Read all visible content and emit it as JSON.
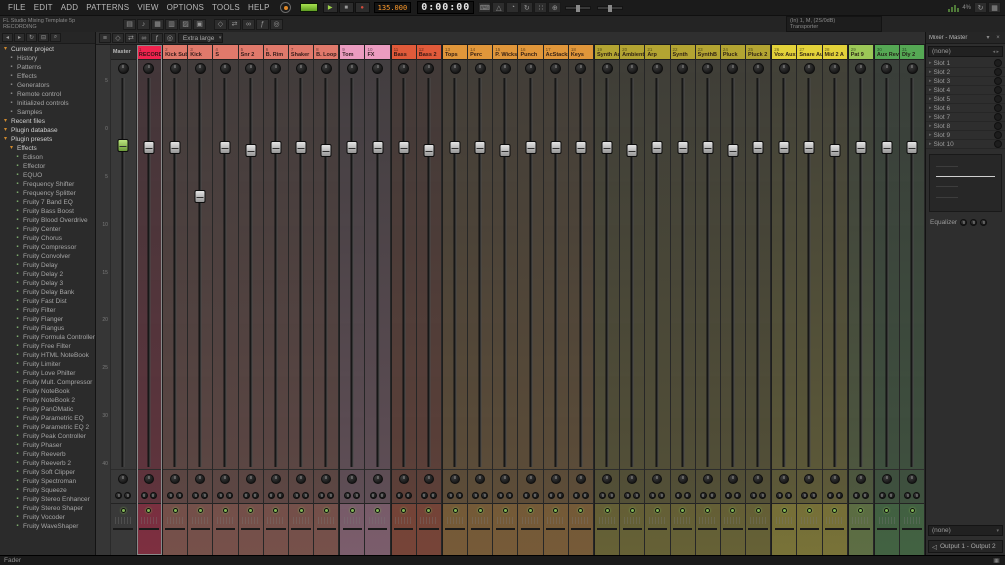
{
  "window": {
    "menu": [
      "FILE",
      "EDIT",
      "ADD",
      "PATTERNS",
      "VIEW",
      "OPTIONS",
      "TOOLS",
      "HELP"
    ],
    "project_title": "FL Studio Mixing Template 5p",
    "pattern_name": "RECORDING",
    "tempo": "135.000",
    "time": "0:00:00",
    "cpu": "4%",
    "hint_line1": "(In) 1, M, (2S/0dB)",
    "hint_line2": "Transporter",
    "transport_icons": [
      "play-icon",
      "stop-icon",
      "record-icon"
    ],
    "tool_icons": [
      "typing-keyboard-icon",
      "metronome-icon",
      "wait-icon",
      "loop-record-icon",
      "step-edit-icon",
      "multilink-icon"
    ],
    "sys_icons": [
      "refresh-icon",
      "monitor-icon"
    ]
  },
  "toolbar2": {
    "panel_icons": [
      "playlist-icon",
      "piano-roll-icon",
      "channel-rack-icon",
      "mixer-icon",
      "browser-icon",
      "plugin-picker-icon"
    ],
    "extra_icons": [
      "snap-icon",
      "swap-icon",
      "link-icon",
      "fx-icon",
      "solo-icon"
    ]
  },
  "browser": {
    "toolbar_icons": [
      "back-icon",
      "forward-icon",
      "refresh-icon",
      "collapse-icon",
      "search-icon"
    ],
    "items": [
      {
        "label": "Current project",
        "depth": 0,
        "type": "folder"
      },
      {
        "label": "History",
        "depth": 1,
        "type": "item"
      },
      {
        "label": "Patterns",
        "depth": 1,
        "type": "item"
      },
      {
        "label": "Effects",
        "depth": 1,
        "type": "item"
      },
      {
        "label": "Generators",
        "depth": 1,
        "type": "item"
      },
      {
        "label": "Remote control",
        "depth": 1,
        "type": "item"
      },
      {
        "label": "Initialized controls",
        "depth": 1,
        "type": "item"
      },
      {
        "label": "Samples",
        "depth": 1,
        "type": "item"
      },
      {
        "label": "Recent files",
        "depth": 0,
        "type": "folder"
      },
      {
        "label": "Plugin database",
        "depth": 0,
        "type": "folder"
      },
      {
        "label": "Plugin presets",
        "depth": 0,
        "type": "folder"
      },
      {
        "label": "Effects",
        "depth": 1,
        "type": "folder"
      },
      {
        "label": "Edison",
        "depth": 2,
        "type": "plugin"
      },
      {
        "label": "Effector",
        "depth": 2,
        "type": "plugin"
      },
      {
        "label": "EQUO",
        "depth": 2,
        "type": "plugin"
      },
      {
        "label": "Frequency Shifter",
        "depth": 2,
        "type": "plugin"
      },
      {
        "label": "Frequency Splitter",
        "depth": 2,
        "type": "plugin"
      },
      {
        "label": "Fruity 7 Band EQ",
        "depth": 2,
        "type": "plugin"
      },
      {
        "label": "Fruity Bass Boost",
        "depth": 2,
        "type": "plugin"
      },
      {
        "label": "Fruity Blood Overdrive",
        "depth": 2,
        "type": "plugin"
      },
      {
        "label": "Fruity Center",
        "depth": 2,
        "type": "plugin"
      },
      {
        "label": "Fruity Chorus",
        "depth": 2,
        "type": "plugin"
      },
      {
        "label": "Fruity Compressor",
        "depth": 2,
        "type": "plugin"
      },
      {
        "label": "Fruity Convolver",
        "depth": 2,
        "type": "plugin"
      },
      {
        "label": "Fruity Delay",
        "depth": 2,
        "type": "plugin"
      },
      {
        "label": "Fruity Delay 2",
        "depth": 2,
        "type": "plugin"
      },
      {
        "label": "Fruity Delay 3",
        "depth": 2,
        "type": "plugin"
      },
      {
        "label": "Fruity Delay Bank",
        "depth": 2,
        "type": "plugin"
      },
      {
        "label": "Fruity Fast Dist",
        "depth": 2,
        "type": "plugin"
      },
      {
        "label": "Fruity Filter",
        "depth": 2,
        "type": "plugin"
      },
      {
        "label": "Fruity Flanger",
        "depth": 2,
        "type": "plugin"
      },
      {
        "label": "Fruity Flangus",
        "depth": 2,
        "type": "plugin"
      },
      {
        "label": "Fruity Formula Controller",
        "depth": 2,
        "type": "plugin"
      },
      {
        "label": "Fruity Free Filter",
        "depth": 2,
        "type": "plugin"
      },
      {
        "label": "Fruity HTML NoteBook",
        "depth": 2,
        "type": "plugin"
      },
      {
        "label": "Fruity Limiter",
        "depth": 2,
        "type": "plugin"
      },
      {
        "label": "Fruity Love Philter",
        "depth": 2,
        "type": "plugin"
      },
      {
        "label": "Fruity Mult. Compressor",
        "depth": 2,
        "type": "plugin"
      },
      {
        "label": "Fruity NoteBook",
        "depth": 2,
        "type": "plugin"
      },
      {
        "label": "Fruity NoteBook 2",
        "depth": 2,
        "type": "plugin"
      },
      {
        "label": "Fruity PanOMatic",
        "depth": 2,
        "type": "plugin"
      },
      {
        "label": "Fruity Parametric EQ",
        "depth": 2,
        "type": "plugin"
      },
      {
        "label": "Fruity Parametric EQ 2",
        "depth": 2,
        "type": "plugin"
      },
      {
        "label": "Fruity Peak Controller",
        "depth": 2,
        "type": "plugin"
      },
      {
        "label": "Fruity Phaser",
        "depth": 2,
        "type": "plugin"
      },
      {
        "label": "Fruity Reeverb",
        "depth": 2,
        "type": "plugin"
      },
      {
        "label": "Fruity Reeverb 2",
        "depth": 2,
        "type": "plugin"
      },
      {
        "label": "Fruity Soft Clipper",
        "depth": 2,
        "type": "plugin"
      },
      {
        "label": "Fruity Spectroman",
        "depth": 2,
        "type": "plugin"
      },
      {
        "label": "Fruity Squeeze",
        "depth": 2,
        "type": "plugin"
      },
      {
        "label": "Fruity Stereo Enhancer",
        "depth": 2,
        "type": "plugin"
      },
      {
        "label": "Fruity Stereo Shaper",
        "depth": 2,
        "type": "plugin"
      },
      {
        "label": "Fruity Vocoder",
        "depth": 2,
        "type": "plugin"
      },
      {
        "label": "Fruity WaveShaper",
        "depth": 2,
        "type": "plugin"
      }
    ]
  },
  "mixer": {
    "view_size": "Extra large",
    "master_label": "Master",
    "master_fader": 0.165,
    "toolbar_icons": [
      "mixer-menu-icon",
      "snap-icon",
      "swap-icon",
      "link-icon",
      "fx-icon",
      "solo-icon"
    ],
    "ruler": [
      "5",
      "0",
      "5",
      "10",
      "15",
      "20",
      "25",
      "30",
      "40"
    ],
    "channels": [
      {
        "num": "1",
        "name": "RECORDING",
        "color": "#f0234e",
        "fader": 0.17,
        "selected": true
      },
      {
        "num": "2",
        "name": "Kick Sub",
        "color": "#e0796b",
        "fader": 0.17
      },
      {
        "num": "3",
        "name": "Kick",
        "color": "#e0796b",
        "fader": 0.3
      },
      {
        "num": "4",
        "name": "S",
        "color": "#e0796b",
        "fader": 0.17
      },
      {
        "num": "5",
        "name": "Snr 2",
        "color": "#e0796b",
        "fader": 0.18
      },
      {
        "num": "6",
        "name": "B. Rim",
        "color": "#e0796b",
        "fader": 0.17
      },
      {
        "num": "7",
        "name": "Shaker",
        "color": "#e0796b",
        "fader": 0.17
      },
      {
        "num": "8",
        "name": "B. Loop",
        "color": "#e0796b",
        "fader": 0.18
      },
      {
        "num": "9",
        "name": "Tom",
        "color": "#eb9cc0",
        "fader": 0.17
      },
      {
        "num": "10",
        "name": "FX",
        "color": "#eb9cc0",
        "fader": 0.17
      },
      {
        "num": "11",
        "name": "Bass",
        "color": "#e05a3a",
        "fader": 0.17
      },
      {
        "num": "12",
        "name": "Bass 2",
        "color": "#e05a3a",
        "fader": 0.18
      },
      {
        "num": "13",
        "name": "Tops",
        "color": "#e0963a",
        "fader": 0.17
      },
      {
        "num": "14",
        "name": "Perc",
        "color": "#e0963a",
        "fader": 0.17
      },
      {
        "num": "15",
        "name": "P. Wicks",
        "color": "#e0963a",
        "fader": 0.18
      },
      {
        "num": "16",
        "name": "Punch",
        "color": "#e0963a",
        "fader": 0.17
      },
      {
        "num": "17",
        "name": "AcStacks",
        "color": "#e0963a",
        "fader": 0.17
      },
      {
        "num": "18",
        "name": "Keys",
        "color": "#e0963a",
        "fader": 0.17
      },
      {
        "num": "19",
        "name": "Synth Aux",
        "color": "#b3a432",
        "fader": 0.17
      },
      {
        "num": "20",
        "name": "Ambient",
        "color": "#b3a432",
        "fader": 0.18
      },
      {
        "num": "21",
        "name": "Arp",
        "color": "#b3a432",
        "fader": 0.17
      },
      {
        "num": "22",
        "name": "Synth",
        "color": "#b3a432",
        "fader": 0.17
      },
      {
        "num": "23",
        "name": "SynthB",
        "color": "#b3a432",
        "fader": 0.17
      },
      {
        "num": "24",
        "name": "Pluck",
        "color": "#b3a432",
        "fader": 0.18
      },
      {
        "num": "25",
        "name": "Pluck 2",
        "color": "#b3a432",
        "fader": 0.17
      },
      {
        "num": "26",
        "name": "Vox Aux",
        "color": "#e3d23a",
        "fader": 0.17
      },
      {
        "num": "27",
        "name": "Snare Aux",
        "color": "#e3d23a",
        "fader": 0.17
      },
      {
        "num": "28",
        "name": "Mid 2 A",
        "color": "#e3d23a",
        "fader": 0.18
      },
      {
        "num": "29",
        "name": "Pat 9",
        "color": "#9cc857",
        "fader": 0.17
      },
      {
        "num": "30",
        "name": "Aux Reverb",
        "color": "#55a854",
        "fader": 0.17
      },
      {
        "num": "31",
        "name": "Dly 2",
        "color": "#55a854",
        "fader": 0.17
      }
    ]
  },
  "right_panel": {
    "title": "Mixer - Master",
    "preset_label": "(none)",
    "slots": [
      "Slot 1",
      "Slot 2",
      "Slot 3",
      "Slot 4",
      "Slot 5",
      "Slot 6",
      "Slot 7",
      "Slot 8",
      "Slot 9",
      "Slot 10"
    ],
    "equalizer_label": "Equalizer",
    "bottom_preset_label": "(none)",
    "output_label": "Output 1 - Output 2"
  },
  "status_bar": {
    "hint": "Fader"
  }
}
